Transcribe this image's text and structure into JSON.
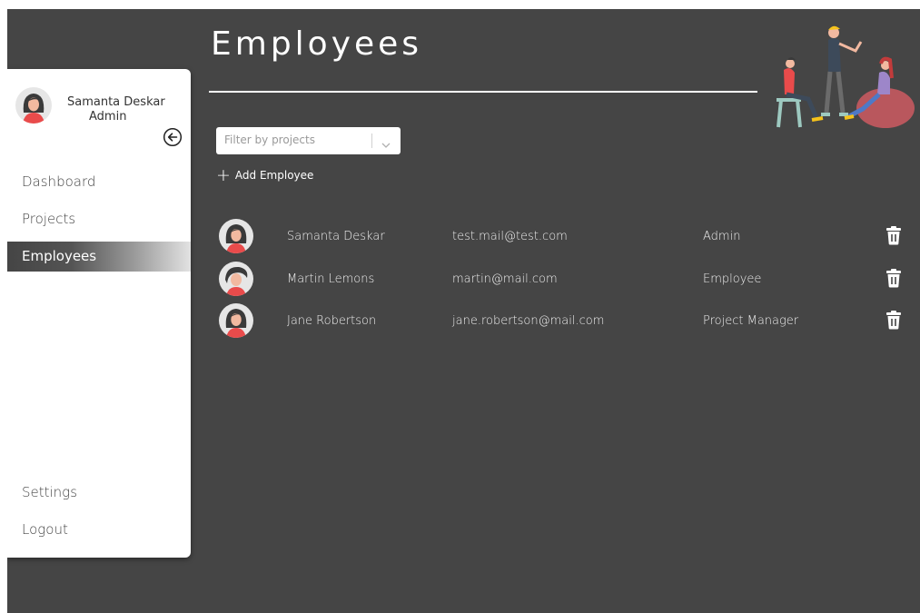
{
  "user": {
    "name": "Samanta Deskar",
    "role": "Admin"
  },
  "page": {
    "title": "Employees"
  },
  "nav": {
    "items": [
      {
        "label": "Dashboard",
        "active": false
      },
      {
        "label": "Projects",
        "active": false
      },
      {
        "label": "Employees",
        "active": true
      }
    ],
    "bottom": [
      {
        "label": "Settings"
      },
      {
        "label": "Logout"
      }
    ]
  },
  "filter": {
    "placeholder": "Filter by projects"
  },
  "actions": {
    "add_employee": "Add Employee"
  },
  "employees": [
    {
      "name": "Samanta Deskar",
      "email": "test.mail@test.com",
      "role": "Admin"
    },
    {
      "name": "Martin Lemons",
      "email": "martin@mail.com",
      "role": "Employee"
    },
    {
      "name": "Jane Robertson",
      "email": "jane.robertson@mail.com",
      "role": "Project Manager"
    }
  ],
  "colors": {
    "background": "#454545",
    "sidebar": "#ffffff",
    "text": "#ffffff"
  },
  "icons": [
    "collapse-arrow-left-icon",
    "chevron-down-icon",
    "plus-icon",
    "trash-icon"
  ]
}
